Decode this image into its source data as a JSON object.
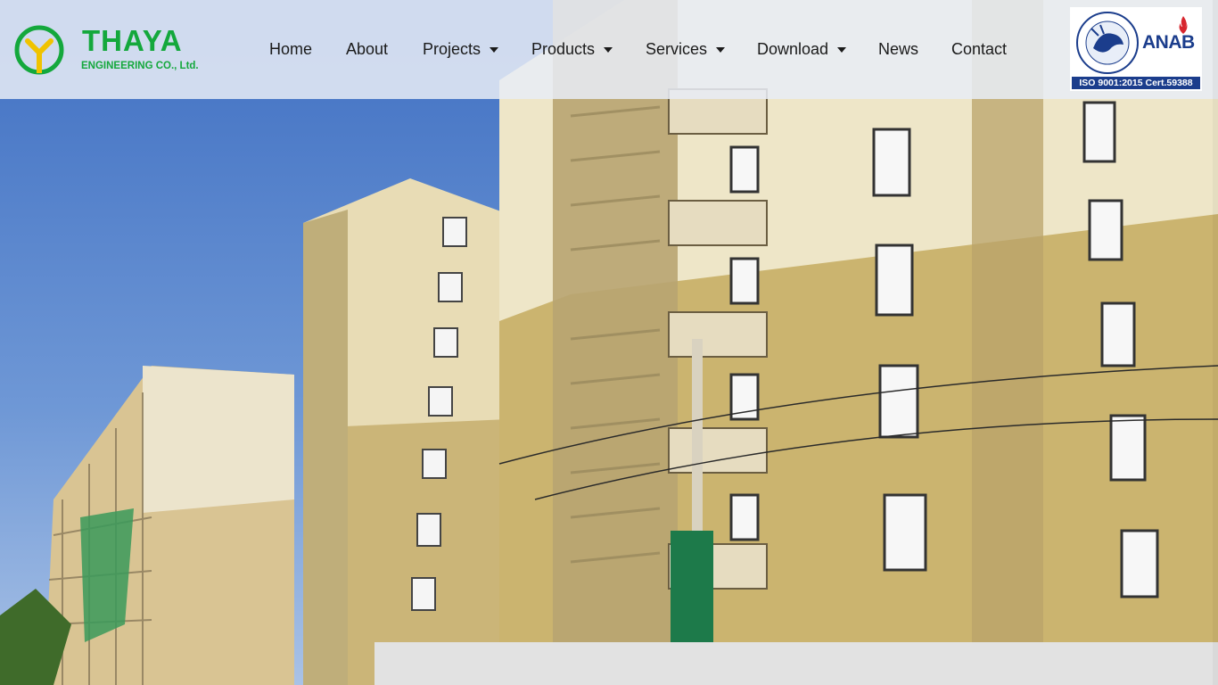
{
  "brand": {
    "name": "THAYA",
    "subtitle": "ENGINEERING CO., Ltd.",
    "primary_color": "#14a83c",
    "accent_color": "#f0c300"
  },
  "nav": {
    "items": [
      {
        "label": "Home",
        "has_dropdown": false
      },
      {
        "label": "About",
        "has_dropdown": false
      },
      {
        "label": "Projects",
        "has_dropdown": true
      },
      {
        "label": "Products",
        "has_dropdown": true
      },
      {
        "label": "Services",
        "has_dropdown": true
      },
      {
        "label": "Download",
        "has_dropdown": true
      },
      {
        "label": "News",
        "has_dropdown": false
      },
      {
        "label": "Contact",
        "has_dropdown": false
      }
    ]
  },
  "certification": {
    "accreditor": "ANAB",
    "banner": "ISO 9001:2015 Cert.59388",
    "brand_color": "#1b3d8c"
  },
  "hero": {
    "icon": "building-photo",
    "sky_color": "#5b85c9"
  }
}
